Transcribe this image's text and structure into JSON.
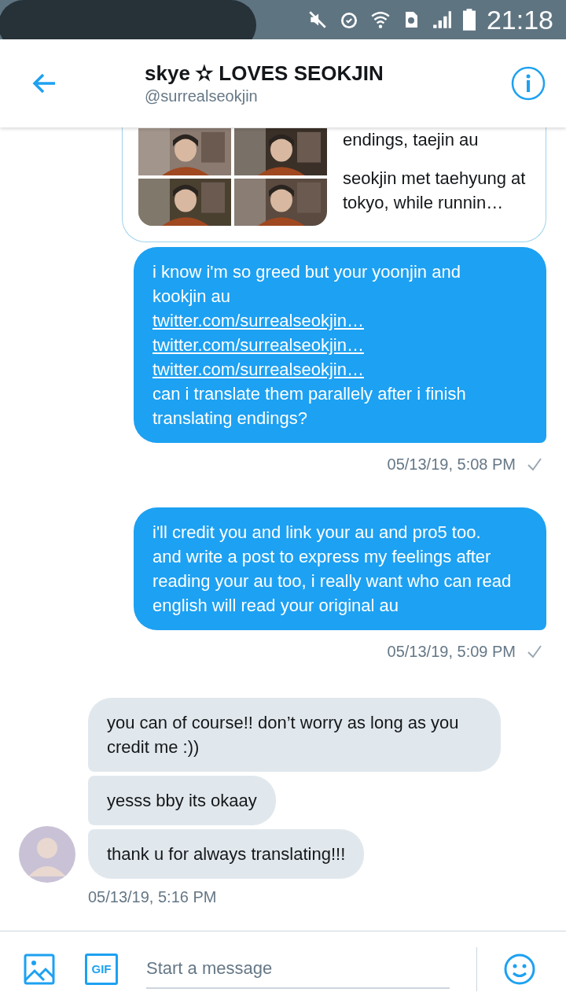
{
  "status_bar": {
    "time": "21:18"
  },
  "header": {
    "name": "skye ✫ LOVES SEOKJIN",
    "handle": "@surrealseokjin"
  },
  "link_card": {
    "texts": [
      "endings, taejin au",
      "seokjin met taehyung at tokyo, while runnin…"
    ],
    "images": [
      {
        "kind": "picture"
      },
      {
        "kind": "picture"
      },
      {
        "kind": "picture"
      },
      {
        "kind": "picture"
      }
    ]
  },
  "messages": [
    {
      "kind": "sent",
      "timestamp": "05/13/19, 5:08 PM",
      "bubbles": [
        {
          "parts": [
            {
              "kind": "text",
              "text": "i know i'm so greed but your yoonjin and kookjin au"
            },
            {
              "kind": "link",
              "text": "twitter.com/surrealseokjin…"
            },
            {
              "kind": "link",
              "text": "twitter.com/surrealseokjin…"
            },
            {
              "kind": "link",
              "text": "twitter.com/surrealseokjin…"
            },
            {
              "kind": "text",
              "text": "can i translate them parallely after i finish translating endings?"
            }
          ]
        }
      ]
    },
    {
      "kind": "sent",
      "timestamp": "05/13/19, 5:09 PM",
      "bubbles": [
        {
          "parts": [
            {
              "kind": "text",
              "text": "i'll credit you and link your au and pro5 too. and write a post to express my feelings after reading your au too, i really want who can read english will read your original au"
            }
          ]
        }
      ]
    },
    {
      "kind": "received",
      "timestamp": "05/13/19, 5:16 PM",
      "bubbles": [
        {
          "parts": [
            {
              "kind": "text",
              "text": "you can of course!! don’t worry as long as you credit me :))"
            }
          ]
        },
        {
          "parts": [
            {
              "kind": "text",
              "text": "yesss bby its okaay"
            }
          ]
        },
        {
          "parts": [
            {
              "kind": "text",
              "text": "thank u for always translating!!!"
            }
          ]
        }
      ]
    }
  ],
  "composer": {
    "placeholder": "Start a message",
    "gif_label": "GIF"
  }
}
